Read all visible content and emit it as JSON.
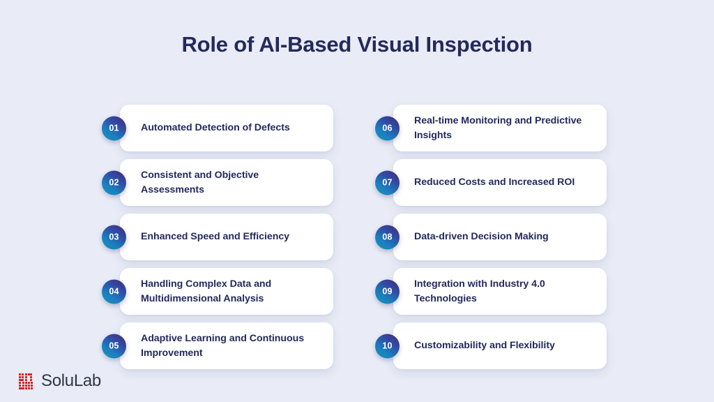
{
  "page": {
    "title": "Role of AI-Based Visual Inspection",
    "background_color": "#e9ecf6",
    "title_color": "#232a5c",
    "card_background": "#ffffff",
    "badge_gradient_from": "#1896b4",
    "badge_gradient_to": "#45257f",
    "text_color": "#232a5c"
  },
  "columns": [
    {
      "name": "left-column",
      "items": [
        {
          "number": "01",
          "label": "Automated Detection of Defects"
        },
        {
          "number": "02",
          "label": "Consistent and Objective Assessments"
        },
        {
          "number": "03",
          "label": "Enhanced Speed and Efficiency"
        },
        {
          "number": "04",
          "label": "Handling Complex Data and Multidimensional Analysis"
        },
        {
          "number": "05",
          "label": "Adaptive Learning and Continuous Improvement"
        }
      ]
    },
    {
      "name": "right-column",
      "items": [
        {
          "number": "06",
          "label": "Real-time Monitoring and Predictive Insights"
        },
        {
          "number": "07",
          "label": "Reduced Costs and Increased ROI"
        },
        {
          "number": "08",
          "label": "Data-driven Decision Making"
        },
        {
          "number": "09",
          "label": "Integration with Industry 4.0 Technologies"
        },
        {
          "number": "10",
          "label": "Customizability and Flexibility"
        }
      ]
    }
  ],
  "logo": {
    "icon": "solulab-pixel-mark-icon",
    "wordmark": "SoluLab",
    "mark_color": "#d6232a",
    "word_color": "#2d3748"
  }
}
